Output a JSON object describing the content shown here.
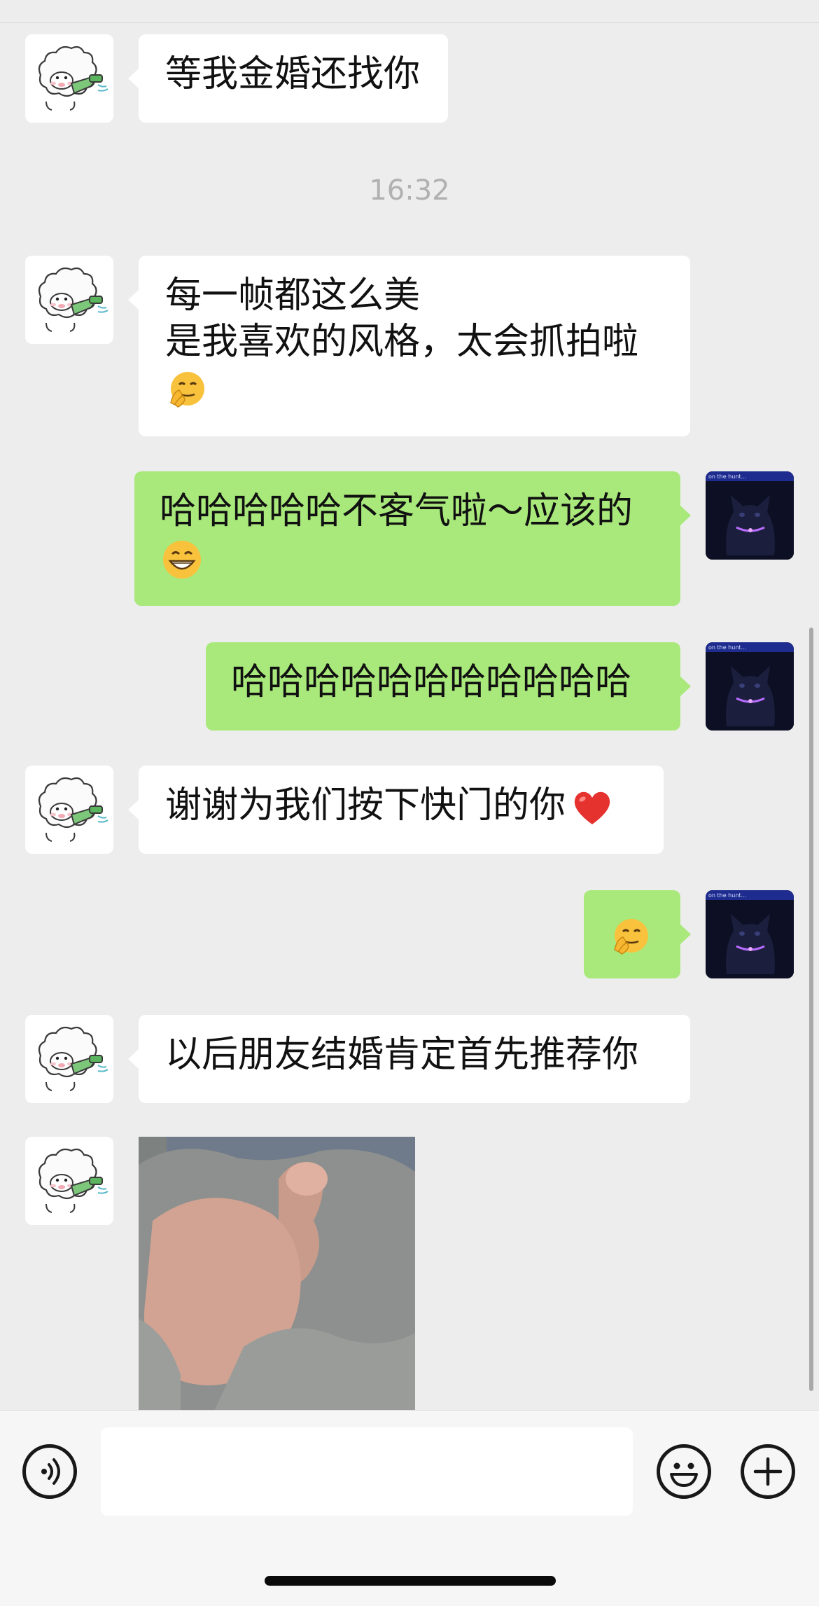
{
  "chat": {
    "timestamp": "16:32",
    "messages": [
      {
        "from": "contact",
        "lines": [
          "等我金婚还找你"
        ]
      },
      {
        "from": "contact",
        "lines": [
          "每一帧都这么美",
          "是我喜欢的风格，太会抓拍啦"
        ],
        "emoji": "shush-face-emoji"
      },
      {
        "from": "me",
        "lines": [
          "哈哈哈哈哈不客气啦～应该的"
        ],
        "emoji": "grin-emoji"
      },
      {
        "from": "me",
        "lines": [
          "哈哈哈哈哈哈哈哈哈哈哈"
        ]
      },
      {
        "from": "contact",
        "lines": [
          "谢谢为我们按下快门的你"
        ],
        "emoji": "red-heart-emoji"
      },
      {
        "from": "me",
        "lines": [],
        "emoji": "shush-face-emoji"
      },
      {
        "from": "contact",
        "lines": [
          "以后朋友结婚肯定首先推荐你"
        ]
      },
      {
        "from": "contact",
        "image": "thumbs-up-photo"
      }
    ],
    "my_avatar_caption": "on the hunt...",
    "colors": {
      "incoming": "#ffffff",
      "outgoing": "#a9e97b",
      "background": "#ededed"
    }
  },
  "inputbar": {
    "voice_icon": "voice-icon",
    "emoji_icon": "emoji-icon",
    "add_icon": "add-icon",
    "message_value": ""
  }
}
